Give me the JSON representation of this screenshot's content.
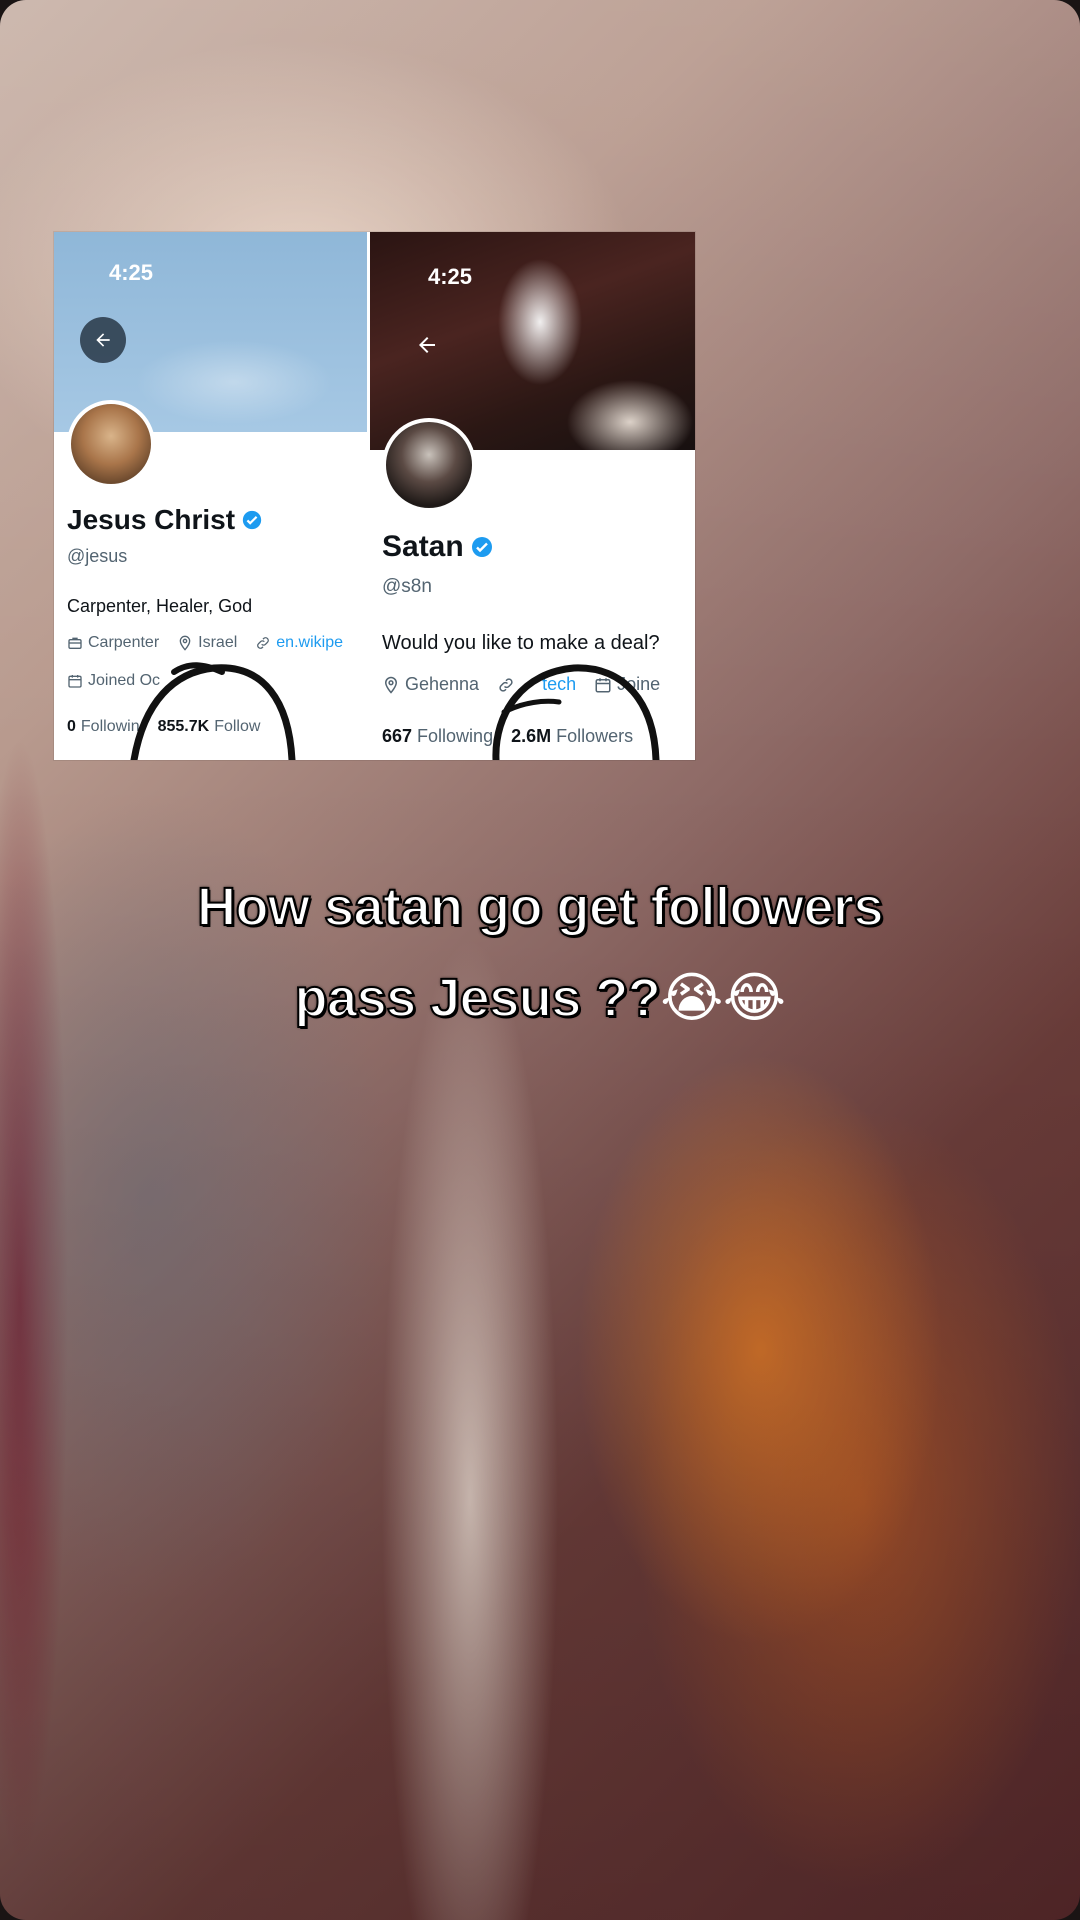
{
  "left_profile": {
    "time": "4:25",
    "name": "Jesus Christ",
    "handle": "@jesus",
    "bio": "Carpenter, Healer, God",
    "job": "Carpenter",
    "location": "Israel",
    "link": "en.wikipe",
    "joined": "Joined Oc",
    "following_count": "0",
    "following_label": "Followin",
    "followers_count": "855.7K",
    "followers_label": "Follow"
  },
  "right_profile": {
    "time": "4:25",
    "name": "Satan",
    "handle": "@s8n",
    "bio": "Would you like to make a deal?",
    "location": "Gehenna",
    "link": "tech",
    "joined": "Joine",
    "following_count": "667",
    "following_label": "Following",
    "followers_count": "2.6M",
    "followers_label": "Followers"
  },
  "caption": {
    "line1": "How satan go get followers",
    "line2": "pass Jesus ??",
    "emoji": "😭😂"
  },
  "colors": {
    "verified": "#1d9bf0",
    "scribble": "#111111",
    "caption_fill": "#ffffff",
    "caption_stroke": "#000000"
  },
  "icons": [
    "back-arrow-icon",
    "verified-badge-icon",
    "briefcase-icon",
    "location-pin-icon",
    "link-icon",
    "calendar-icon"
  ]
}
